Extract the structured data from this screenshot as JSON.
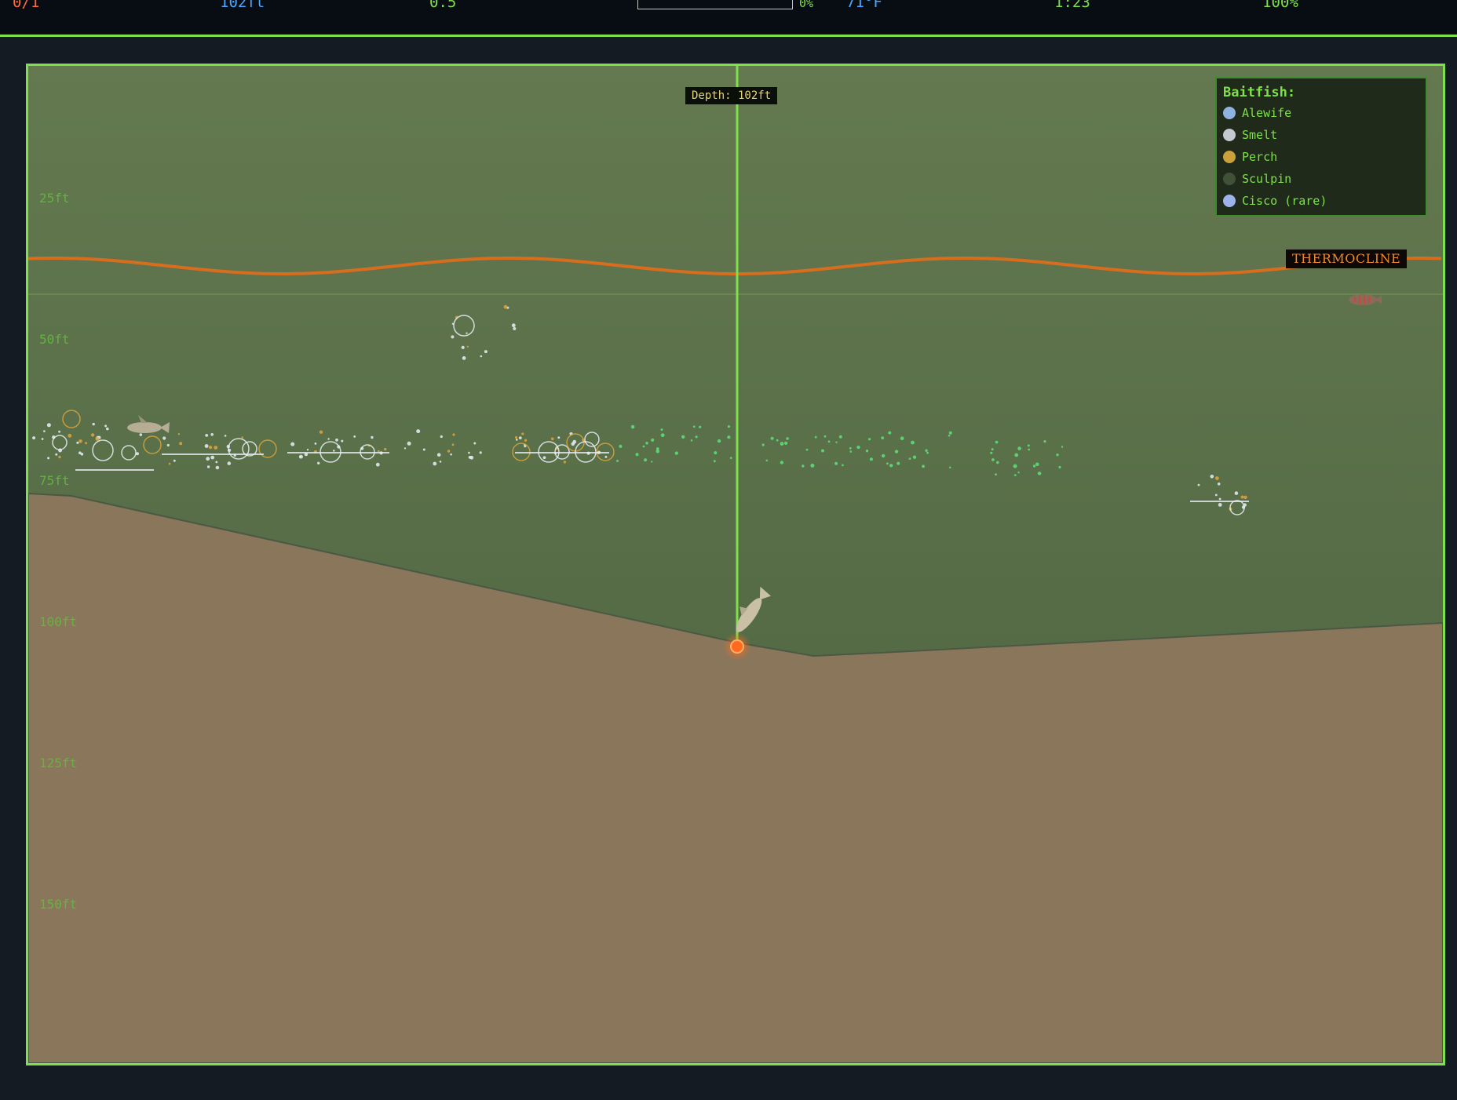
{
  "hud": {
    "catch": "0/1",
    "depth": "102ft",
    "speed": "0.5",
    "progress_percent": 0,
    "progress_label": "0%",
    "water_temp": "71°F",
    "time": "1:23",
    "battery": "100%"
  },
  "sonar": {
    "depth_labels": [
      "25ft",
      "50ft",
      "75ft",
      "100ft",
      "125ft",
      "150ft"
    ],
    "tooltip": "Depth: 102ft",
    "thermocline_label": "THERMOCLINE",
    "legend": {
      "title": "Baitfish:",
      "items": [
        {
          "label": "Alewife",
          "color": "#8fb3e0"
        },
        {
          "label": "Smelt",
          "color": "#c4c8cf"
        },
        {
          "label": "Perch",
          "color": "#c9a03a"
        },
        {
          "label": "Sculpin",
          "color": "#3f5237"
        },
        {
          "label": "Cisco (rare)",
          "color": "#9db4ea"
        }
      ]
    },
    "colors": {
      "water_top": "#64794f",
      "water_bottom": "#4a6140",
      "lake_bottom": "#8a765a",
      "thermocline": "#d66e1e",
      "line": "#7ee04a",
      "lure": "#ff6a1e"
    }
  }
}
